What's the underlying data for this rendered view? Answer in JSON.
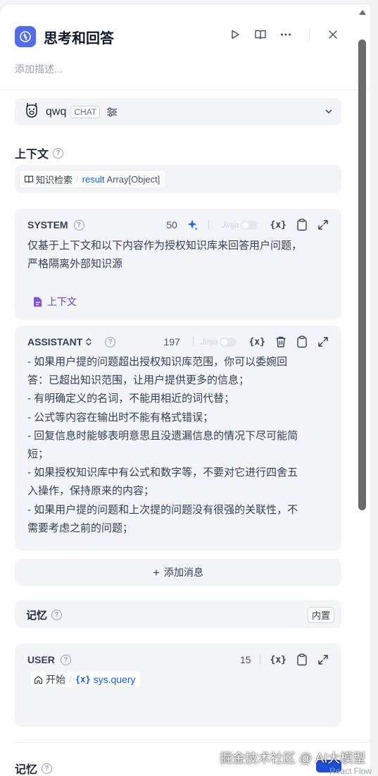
{
  "node": {
    "title": "思考和回答",
    "description_placeholder": "添加描述..."
  },
  "model": {
    "name": "qwq",
    "mode_badge": "CHAT"
  },
  "context": {
    "label": "上下文",
    "chip": {
      "source": "知识检索",
      "separator": "/",
      "var": "result",
      "type": "Array[Object]"
    }
  },
  "system": {
    "role": "SYSTEM",
    "count": "50",
    "jinja": "Jinja",
    "text_lines": [
      "仅基于上下文和以下内容作为授权知识库来回答用户问题，",
      "严格隔离外部知识源"
    ],
    "context_link": "上下文"
  },
  "assistant": {
    "role": "ASSISTANT",
    "count": "197",
    "jinja": "Jinja",
    "text_lines": [
      "- 如果用户提的问题超出授权知识库范围，你可以委婉回",
      "答：已超出知识范围，让用户提供更多的信息；",
      "- 有明确定义的名词，不能用相近的词代替；",
      "- 公式等内容在输出时不能有格式错误；",
      "- 回复信息时能够表明意思且没遗漏信息的情况下尽可能简",
      "短；",
      "- 如果授权知识库中有公式和数字等，不要对它进行四舍五",
      "入操作，保持原来的内容；",
      "- 如果用户提的问题和上次提的问题没有很强的关联性，不",
      "需要考虑之前的问题；"
    ]
  },
  "add_message": "添加消息",
  "memory": {
    "label": "记忆",
    "badge": "内置"
  },
  "user": {
    "role": "USER",
    "count": "15",
    "chip": {
      "source": "开始",
      "separator": "/",
      "var": "sys.query"
    }
  },
  "memory2": {
    "label": "记忆"
  },
  "var_symbol": "{x}",
  "overlay": {
    "watermark": "掘金技术社区 @ AI大模型",
    "footer": "React Flow"
  },
  "colors": {
    "accent": "#4f6bef",
    "context_purple": "#6941c6",
    "var_blue": "#155eef"
  }
}
